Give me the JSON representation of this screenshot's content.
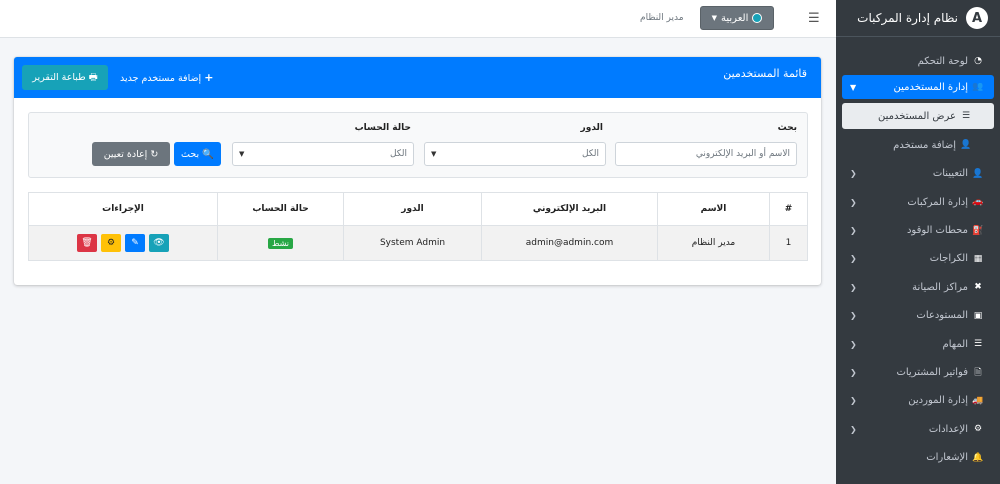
{
  "brand": {
    "title": "نظام إدارة المركبات",
    "logo_letter": "A"
  },
  "topbar": {
    "lang_label": "العربية",
    "user_name": "مدير النظام"
  },
  "sidebar": {
    "items": [
      {
        "label": "لوحة التحكم",
        "icon": "dashboard-icon"
      },
      {
        "label": "إدارة المستخدمين",
        "icon": "users-icon",
        "active": true
      },
      {
        "label": "عرض المستخدمين",
        "icon": "list-icon",
        "sub_active": true
      },
      {
        "label": "إضافة مستخدم",
        "icon": "user-plus-icon"
      },
      {
        "label": "التعيينات",
        "icon": "user-icon"
      },
      {
        "label": "إدارة المركبات",
        "icon": "car-icon"
      },
      {
        "label": "محطات الوقود",
        "icon": "gas-pump-icon"
      },
      {
        "label": "الكراجات",
        "icon": "warehouse-icon"
      },
      {
        "label": "مراكز الصيانة",
        "icon": "tools-icon"
      },
      {
        "label": "المستودعات",
        "icon": "boxes-icon"
      },
      {
        "label": "المهام",
        "icon": "tasks-icon"
      },
      {
        "label": "فواتير المشتريات",
        "icon": "invoice-icon"
      },
      {
        "label": "إدارة الموردين",
        "icon": "truck-icon"
      },
      {
        "label": "الإعدادات",
        "icon": "gear-icon"
      },
      {
        "label": "الإشعارات",
        "icon": "bell-icon"
      }
    ]
  },
  "card": {
    "title": "قائمة المستخدمين",
    "add_label": "إضافة مستخدم جديد",
    "print_label": "طباعة التقرير"
  },
  "filters": {
    "search_label": "بحث",
    "search_placeholder": "الاسم أو البريد الإلكتروني",
    "role_label": "الدور",
    "role_value": "الكل",
    "status_label": "حالة الحساب",
    "status_value": "الكل",
    "search_button": "بحث",
    "reset_button": "إعادة تعيين"
  },
  "table": {
    "headers": [
      "#",
      "الاسم",
      "البريد الإلكتروني",
      "الدور",
      "حالة الحساب",
      "الإجراءات"
    ],
    "rows": [
      {
        "num": "1",
        "name": "مدير النظام",
        "email": "admin@admin.com",
        "role": "System Admin",
        "status": "نشط"
      }
    ]
  },
  "colors": {
    "primary": "#007bff",
    "info": "#17a2b8",
    "sidebar": "#343a40",
    "success": "#28a745",
    "danger": "#dc3545",
    "warning": "#ffc107"
  }
}
